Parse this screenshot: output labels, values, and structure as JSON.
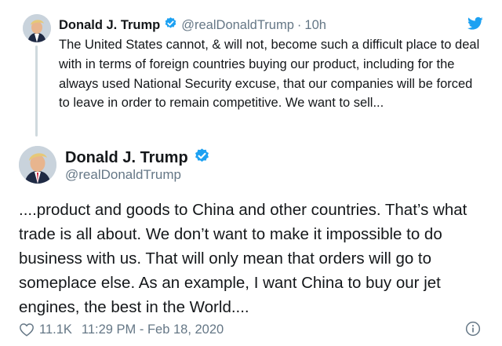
{
  "quoted_tweet": {
    "display_name": "Donald J. Trump",
    "handle": "@realDonaldTrump",
    "separator": "·",
    "time_ago": "10h",
    "text": "The United States cannot, & will not, become such a difficult place to deal with in terms of foreign countries buying our product, including for the always used National Security excuse, that our companies will be forced to leave in order to remain competitive. We want to sell..."
  },
  "main_tweet": {
    "display_name": "Donald J. Trump",
    "handle": "@realDonaldTrump",
    "text": "....product and goods to China and other countries. That’s what trade is all about. We don’t want to make it impossible to do business with us. That will only mean that orders will go to someplace else. As an example, I want China to buy our jet engines, the best in the World....",
    "likes": "11.1K",
    "timestamp": "11:29 PM - Feb 18, 2020"
  },
  "icons": {
    "verified": "verified-badge-icon",
    "twitter": "twitter-bird-icon",
    "like": "heart-icon",
    "info": "info-icon"
  },
  "colors": {
    "brand_blue": "#1da1f2",
    "secondary_text": "#657786",
    "primary_text": "#14171a",
    "thread_line": "#cfd9de"
  }
}
